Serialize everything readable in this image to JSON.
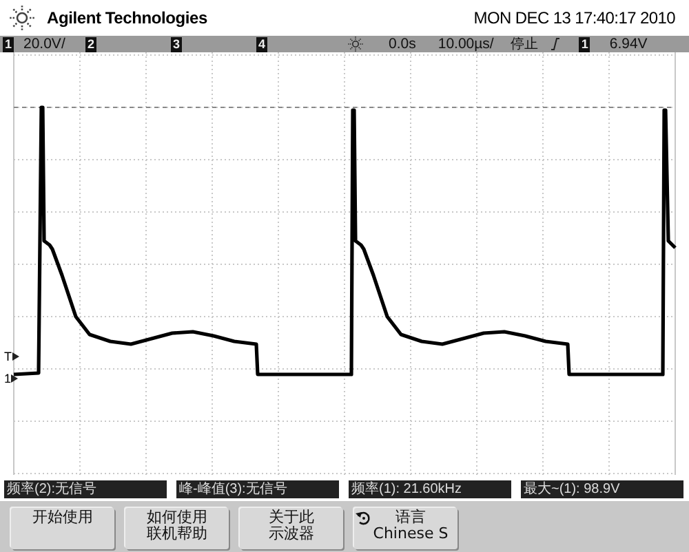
{
  "header": {
    "brand": "Agilent Technologies",
    "datetime": "MON DEC 13 17:40:17 2010"
  },
  "channel_bar": {
    "channels": [
      {
        "number": "1",
        "scale": "20.0V/"
      },
      {
        "number": "2"
      },
      {
        "number": "3"
      },
      {
        "number": "4"
      }
    ],
    "delay": "0.0s",
    "timebase": "10.00µs/",
    "run_state": "停止",
    "trigger_channel": "1",
    "trigger_level": "6.94V"
  },
  "screen": {
    "markers": [
      {
        "label": "T"
      },
      {
        "label": "1"
      }
    ]
  },
  "measurements": [
    "频率(2):无信号",
    "峰-峰值(3):无信号",
    "频率(1): 21.60kHz",
    "最大~(1): 98.9V"
  ],
  "softkeys": [
    {
      "kind": "plain",
      "lines": [
        "开始使用"
      ]
    },
    {
      "kind": "plain",
      "lines": [
        "如何使用",
        "联机帮助"
      ]
    },
    {
      "kind": "plain",
      "lines": [
        "关于此",
        "示波器"
      ]
    },
    {
      "kind": "return",
      "lines": [
        "语言",
        "Chinese S"
      ]
    }
  ]
}
